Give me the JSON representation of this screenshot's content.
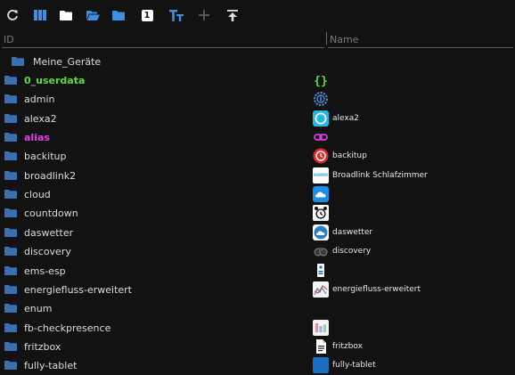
{
  "toolbar": {
    "icons": [
      "refresh-icon",
      "columns-icon",
      "folder-icon",
      "folder-open-icon",
      "folder-closed-icon",
      "number-one-icon",
      "text-size-icon",
      "plus-icon",
      "upload-icon"
    ],
    "number_one_label": "1",
    "text_size_label": "TT"
  },
  "columns": {
    "id": "ID",
    "name": "Name"
  },
  "root": {
    "label": "Meine_Geräte"
  },
  "rows": [
    {
      "id": "0_userdata",
      "id_color": "#5cdc3f",
      "name": "",
      "icon": "braces-icon"
    },
    {
      "id": "admin",
      "name": "",
      "icon": "admin-gear-icon"
    },
    {
      "id": "alexa2",
      "name": "alexa2",
      "icon": "alexa-icon"
    },
    {
      "id": "alias",
      "id_color": "#e040e0",
      "name": "",
      "icon": "link-icon"
    },
    {
      "id": "backitup",
      "name": "backitup",
      "icon": "backitup-icon"
    },
    {
      "id": "broadlink2",
      "name": "Broadlink Schlafzimmer",
      "icon": "broadlink-icon"
    },
    {
      "id": "cloud",
      "name": "",
      "icon": "cloud-icon"
    },
    {
      "id": "countdown",
      "name": "",
      "icon": "alarm-clock-icon"
    },
    {
      "id": "daswetter",
      "name": "daswetter",
      "icon": "weather-icon"
    },
    {
      "id": "discovery",
      "name": "discovery",
      "icon": "discovery-icon"
    },
    {
      "id": "ems-esp",
      "name": "",
      "icon": "ems-esp-icon"
    },
    {
      "id": "energiefluss-erweitert",
      "name": "energiefluss-erweitert",
      "icon": "energy-flow-icon"
    },
    {
      "id": "enum",
      "name": "",
      "icon": ""
    },
    {
      "id": "fb-checkpresence",
      "name": "",
      "icon": "presence-icon"
    },
    {
      "id": "fritzbox",
      "name": "fritzbox",
      "icon": "document-icon"
    },
    {
      "id": "fully-tablet",
      "name": "fully-tablet",
      "icon": "tablet-icon"
    }
  ]
}
